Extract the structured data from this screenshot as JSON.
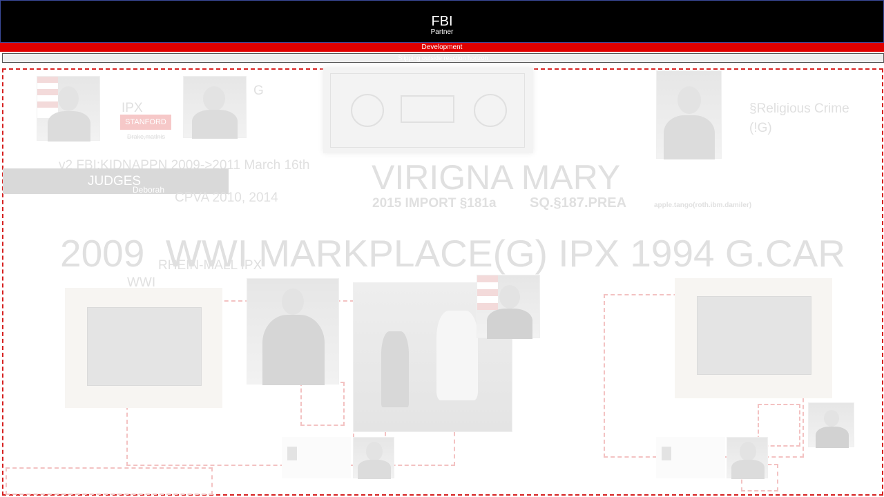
{
  "header": {
    "title": "FBI",
    "subtitle": "Partner"
  },
  "red_bar": {
    "label": "Development"
  },
  "grey_bar": {
    "label": "Slipping outside reaction horizon"
  },
  "labels": {
    "ipx": "IPX",
    "stanford": "STANFORD",
    "drake": "Drake,matlnis",
    "g": "G",
    "religious": "§Religious Crime (!G)",
    "kidnap": "v2 FBI:KIDNAPPN 2009->2011 March 16th",
    "judges": "JUDGES",
    "deborah": "Deborah",
    "cpva": "CPVA 2010, 2014",
    "virigna": "VIRIGNA MARY",
    "import": "2015 IMPORT §181a",
    "sq": "SQ.§187.PREA",
    "apple": "apple.tango(roth.ibm.damiler)",
    "big_line": "2009  WWI MARKPLACE(G) IPX 1994 G.CAR",
    "rhein": "RHEIN-MALL IPX",
    "wwi": "WWI"
  },
  "colors": {
    "top_bar": "#000000",
    "red_bar": "#e00000",
    "frame_border": "#d62020",
    "faint_text": "#e0e0e0"
  }
}
